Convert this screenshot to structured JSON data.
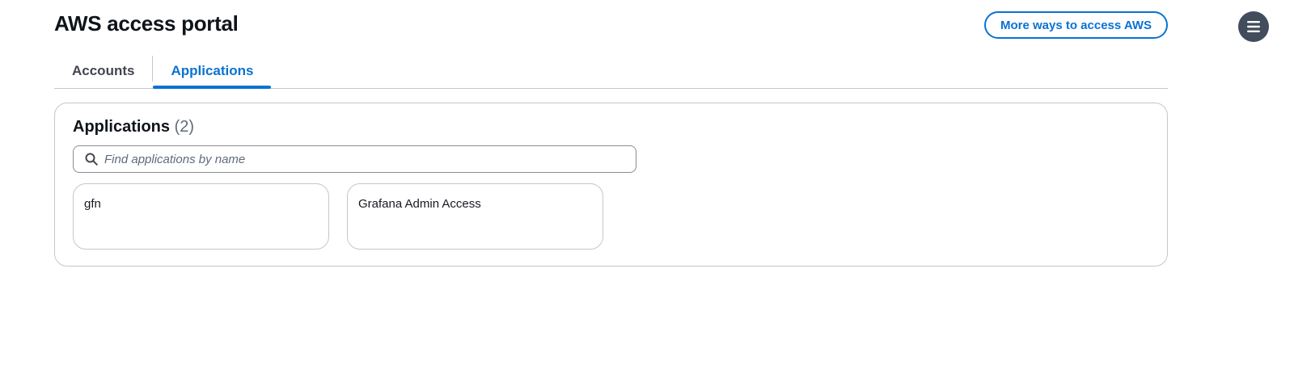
{
  "header": {
    "title": "AWS access portal",
    "more_ways_label": "More ways to access AWS",
    "menu_icon": "hamburger-menu-icon"
  },
  "tabs": [
    {
      "label": "Accounts",
      "active": false
    },
    {
      "label": "Applications",
      "active": true
    }
  ],
  "applications": {
    "heading": "Applications",
    "count": "(2)",
    "search": {
      "placeholder": "Find applications by name",
      "value": "",
      "icon": "search-icon"
    },
    "items": [
      {
        "name": "gfn"
      },
      {
        "name": "Grafana Admin Access"
      }
    ]
  },
  "colors": {
    "accent": "#0972d3",
    "border": "#c6c6cd",
    "menu_bg": "#414d5c"
  }
}
